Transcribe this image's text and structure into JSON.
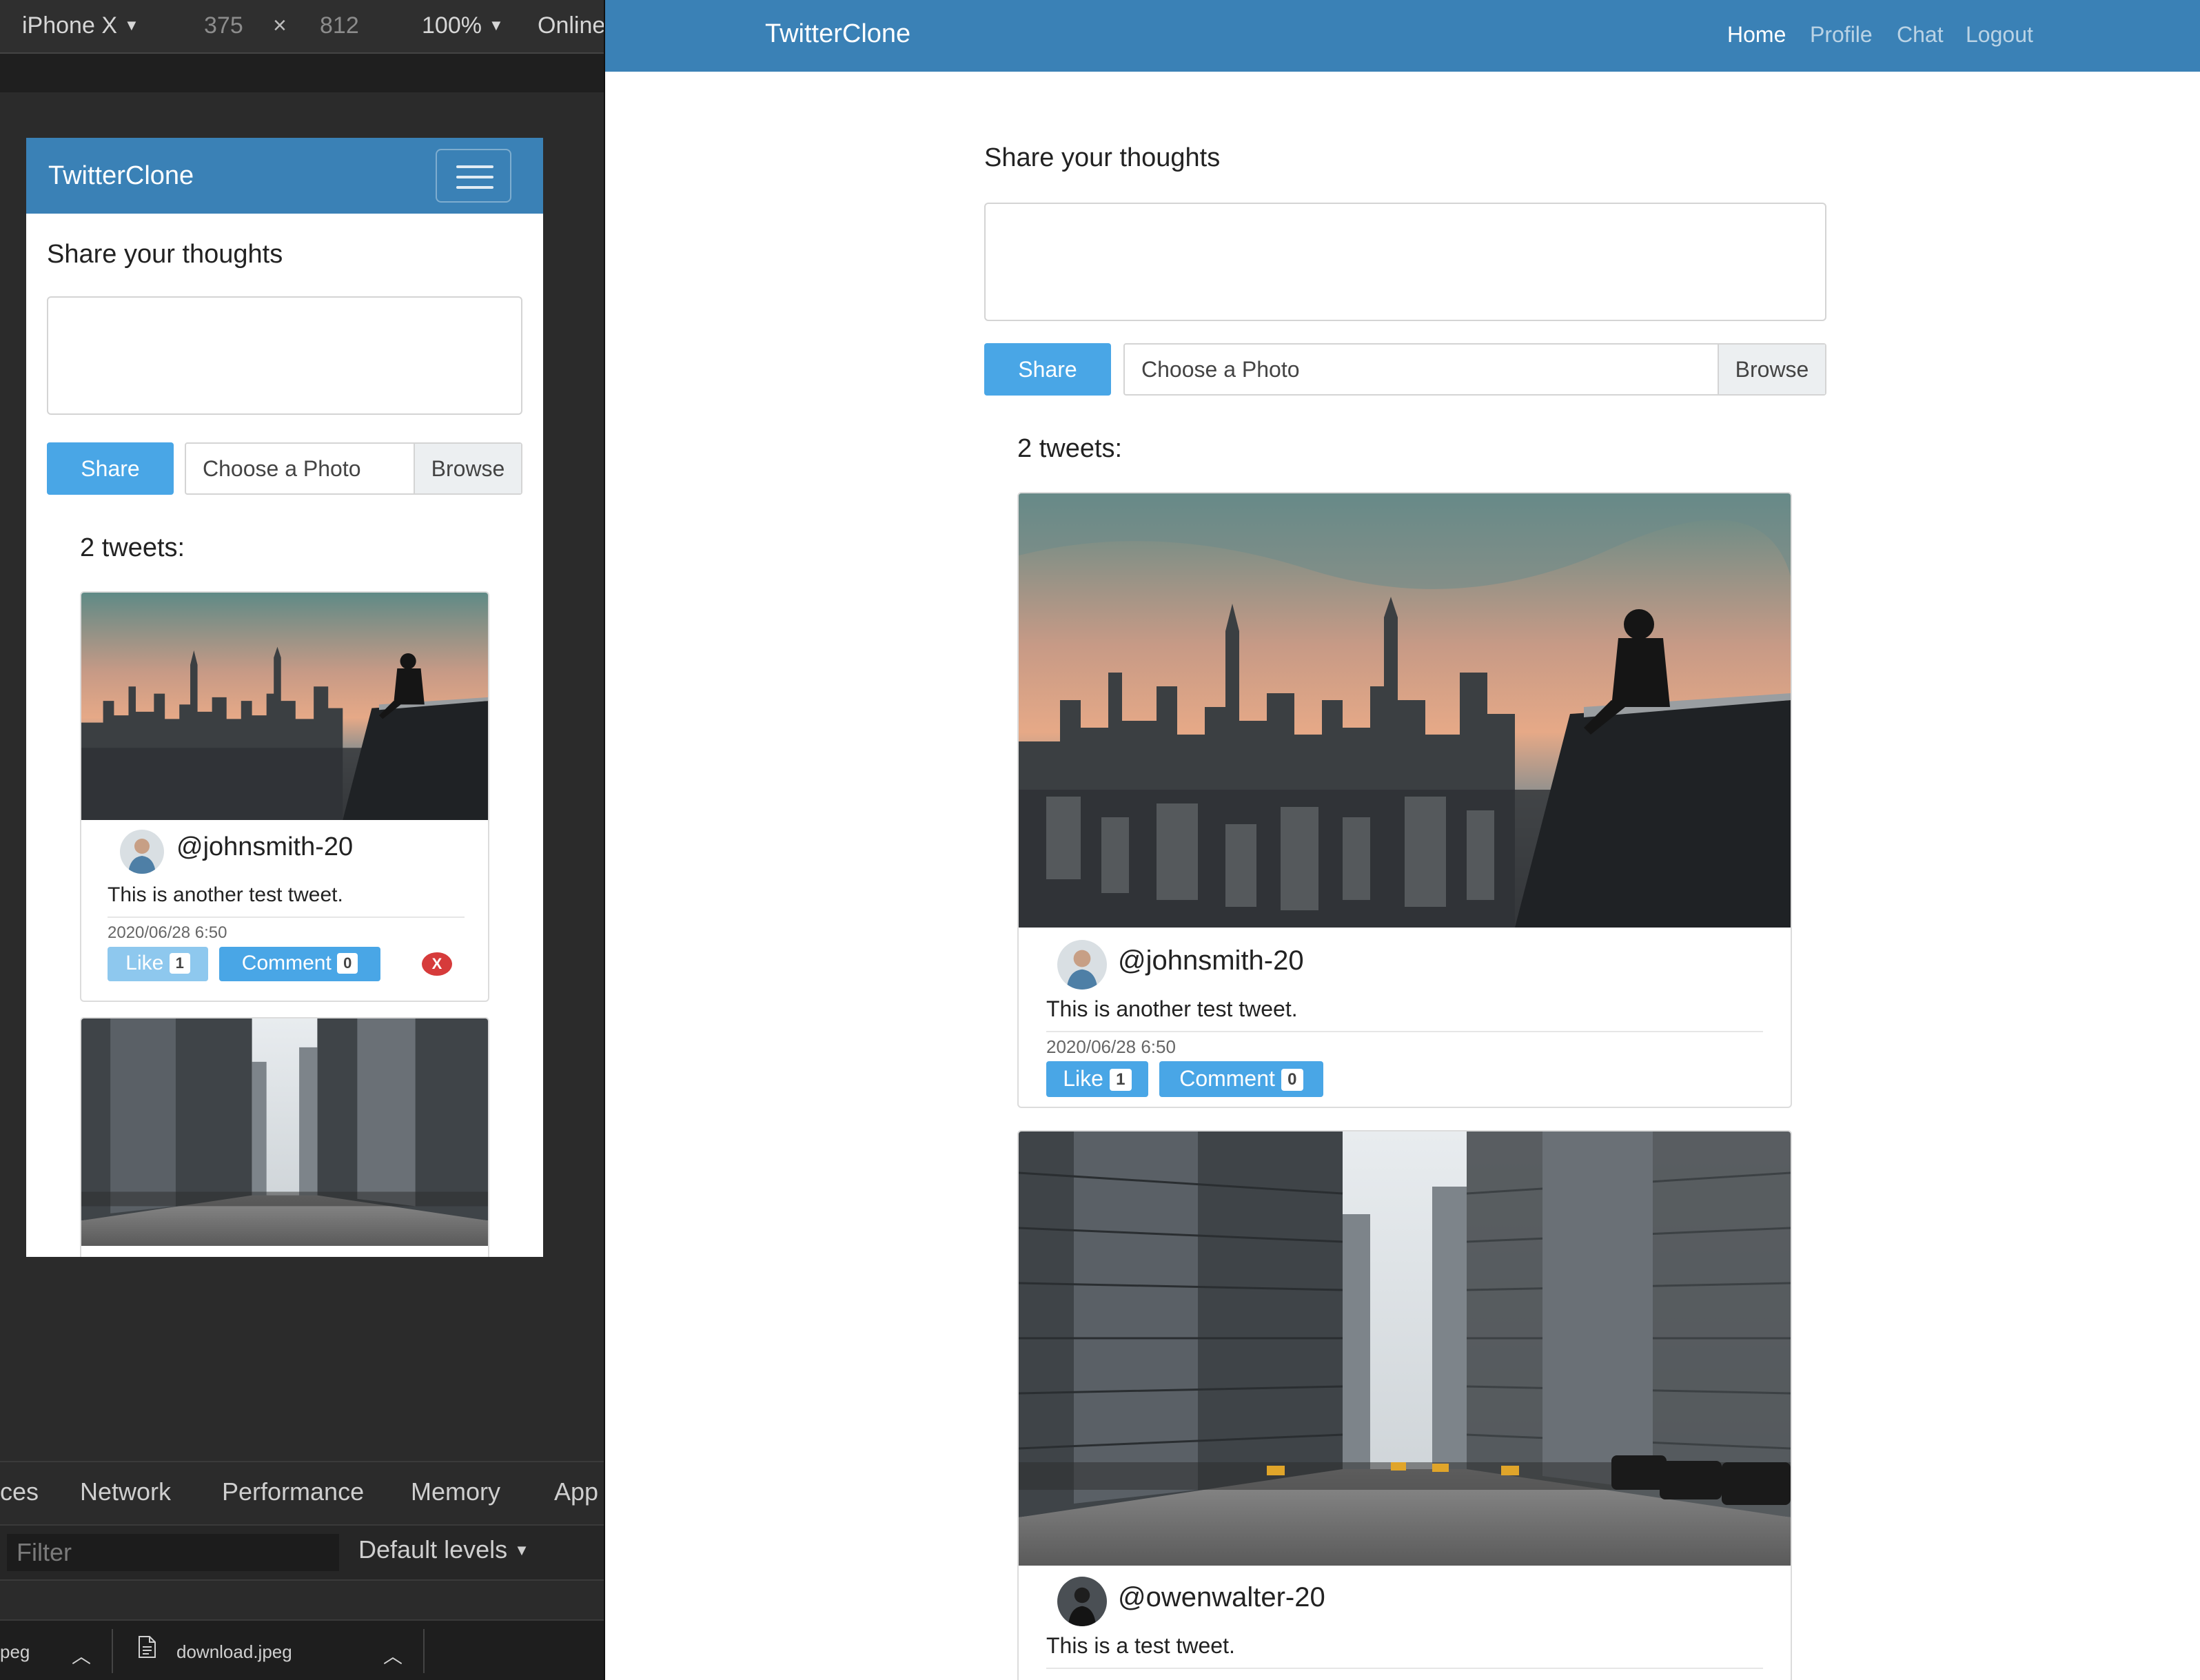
{
  "devtools": {
    "device": "iPhone X",
    "width": "375",
    "times": "×",
    "height": "812",
    "zoom": "100%",
    "network": "Online",
    "tabs": [
      "ces",
      "Network",
      "Performance",
      "Memory",
      "App"
    ],
    "filter_placeholder": "Filter",
    "levels": "Default levels",
    "downloads": [
      "peg",
      "download.jpeg"
    ]
  },
  "app": {
    "brand": "TwitterClone",
    "nav": [
      "Home",
      "Profile",
      "Chat",
      "Logout"
    ],
    "share_title": "Share your thoughts",
    "share_button": "Share",
    "file_placeholder": "Choose a Photo",
    "browse": "Browse",
    "tweet_count": "2 tweets:",
    "tweets": [
      {
        "handle": "@johnsmith-20",
        "text": "This is another test tweet.",
        "date": "2020/06/28 6:50",
        "like_label": "Like",
        "likes": "1",
        "comment_label": "Comment",
        "comments": "0",
        "delete": "X"
      },
      {
        "handle": "@owenwalter-20",
        "text": "This is a test tweet."
      }
    ]
  },
  "colors": {
    "navbar": "#3a81b6",
    "primary": "#49a6e6",
    "danger": "#d63b3b"
  }
}
